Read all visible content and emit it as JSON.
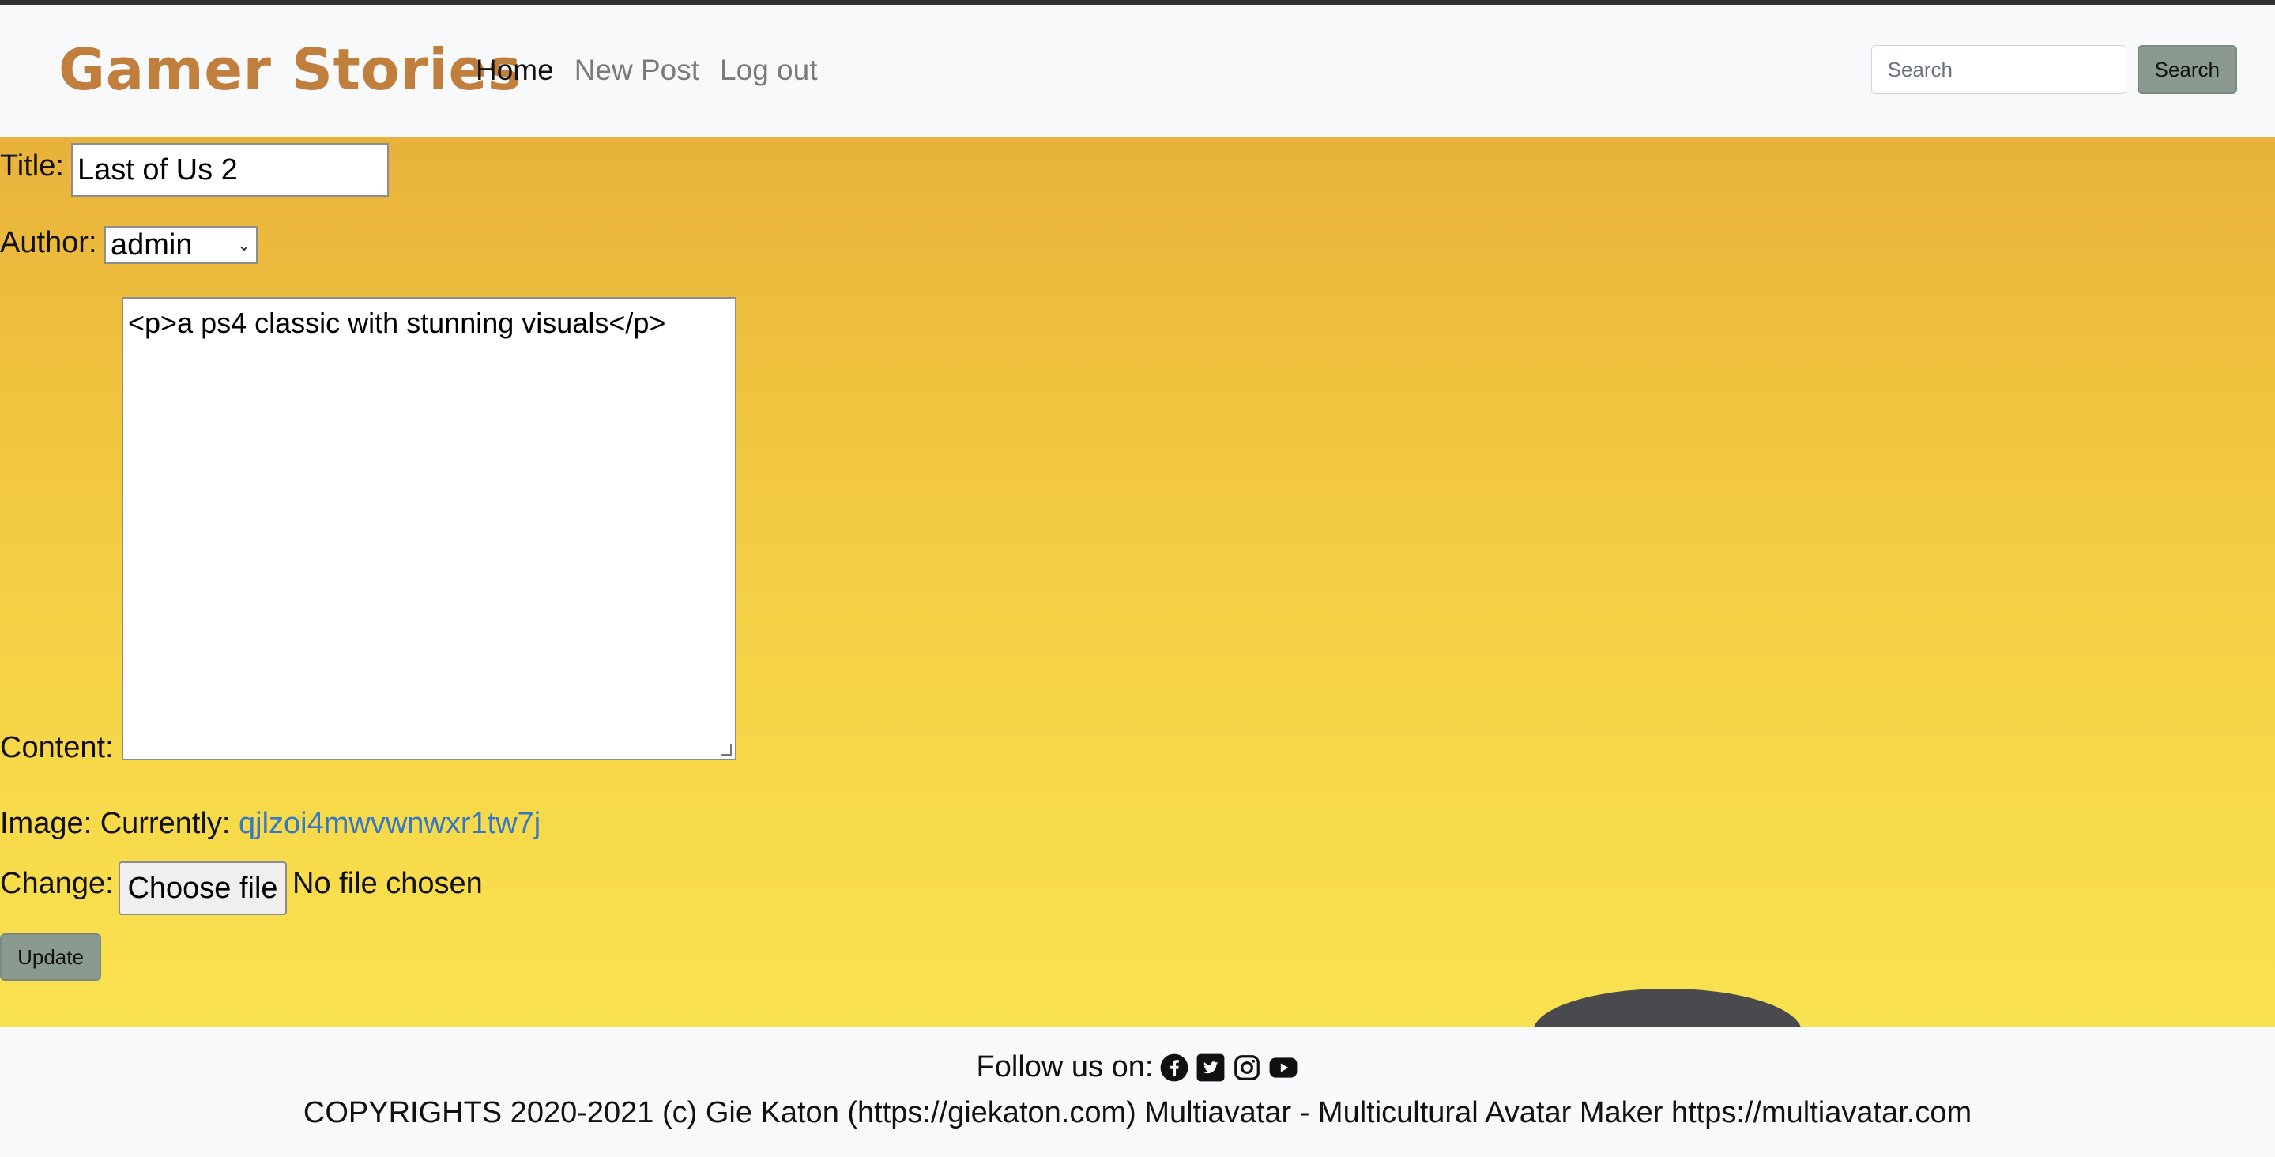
{
  "navbar": {
    "brand": "Gamer Stories",
    "links": [
      "Home",
      "New Post",
      "Log out"
    ],
    "search_placeholder": "Search",
    "search_button": "Search"
  },
  "form": {
    "title_label": "Title:",
    "title_value": "Last of Us 2",
    "author_label": "Author:",
    "author_value": "admin",
    "content_label": "Content:",
    "content_value": "<p>a ps4 classic with stunning visuals</p>",
    "image_label": "Image:",
    "currently_label": "Currently:",
    "image_filename": "qjlzoi4mwvwnwxr1tw7j",
    "change_label": "Change:",
    "choose_file_button": "Choose file",
    "no_file_text": "No file chosen",
    "update_button": "Update"
  },
  "footer": {
    "follow_text": "Follow us on:",
    "social_icons": [
      "facebook-icon",
      "twitter-icon",
      "instagram-icon",
      "youtube-icon"
    ],
    "copyright": "COPYRIGHTS 2020-2021 (c) Gie Katon (https://giekaton.com) Multiavatar - Multicultural Avatar Maker https://multiavatar.com"
  },
  "colors": {
    "brand": "#c17f3e",
    "button": "#8a9a8f",
    "link": "#3578c5",
    "background_top": "#e8b23b",
    "background_bottom": "#f9e24f"
  }
}
